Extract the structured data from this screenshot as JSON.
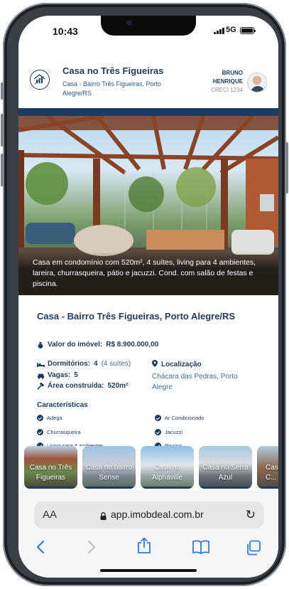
{
  "status_bar": {
    "time": "10:43",
    "network": "5G"
  },
  "header": {
    "title": "Casa no Três Figueiras",
    "subtitle": "Casa - Bairro Três Figueiras, Porto Alegre/RS",
    "agent_name": "BRUNO HENRIQUE",
    "agent_id": "CRECI 1234"
  },
  "hero": {
    "caption": "Casa em condomínio com 520m², 4 suítes, living para 4 ambientes, lareira, churrasqueira, pátio e jacuzzi. Cond. com salão de festas e piscina."
  },
  "details": {
    "heading": "Casa - Bairro Três Figueiras, Porto Alegre/RS",
    "price_label": "Valor do imóvel:",
    "price_value": "R$ 8.900.000,00",
    "bedrooms_label": "Dormitórios:",
    "bedrooms_value": "4",
    "bedrooms_extra": "(4 suítes)",
    "parking_label": "Vagas:",
    "parking_value": "5",
    "area_label": "Área construída:",
    "area_value": "520m²",
    "location_label": "Localização",
    "location_value": "Chácara das Pedras, Porto Alegre",
    "features_title": "Características",
    "features": [
      "Adega",
      "Ar Condicionado",
      "Churrasqueira",
      "Jacuzzi",
      "Living para 4 ambientes",
      "Piscina"
    ]
  },
  "related_cards": [
    "Casa no Três Figueiras",
    "Casa no bairro Sense",
    "Casa no Alphaville",
    "Casa no Serra Azul",
    "Casa no b... C..."
  ],
  "browser": {
    "text_size": "AA",
    "url": "app.imobdeal.com.br"
  },
  "colors": {
    "brand": "#1e3a5f",
    "accent_text": "#3f6fa0",
    "safari_blue": "#2b7cf0"
  }
}
